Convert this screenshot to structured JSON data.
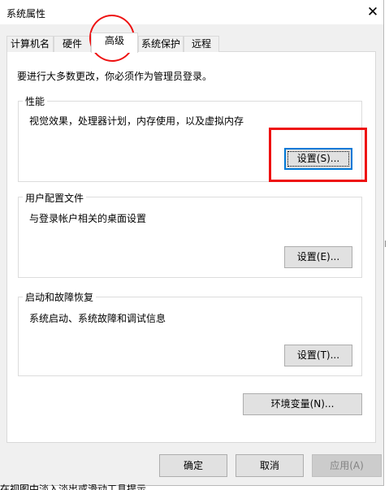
{
  "window": {
    "title": "系统属性",
    "close_symbol": "✕"
  },
  "tabs": [
    {
      "label": "计算机名"
    },
    {
      "label": "硬件"
    },
    {
      "label": "高级"
    },
    {
      "label": "系统保护"
    },
    {
      "label": "远程"
    }
  ],
  "intro": "要进行大多数更改，你必须作为管理员登录。",
  "performance": {
    "title": "性能",
    "desc": "视觉效果，处理器计划，内存使用，以及虚拟内存",
    "button": "设置(S)..."
  },
  "profiles": {
    "title": "用户配置文件",
    "desc": "与登录帐户相关的桌面设置",
    "button": "设置(E)..."
  },
  "startup": {
    "title": "启动和故障恢复",
    "desc": "系统启动、系统故障和调试信息",
    "button": "设置(T)..."
  },
  "env_button": "环境变量(N)...",
  "footer": {
    "ok": "确定",
    "cancel": "取消",
    "apply": "应用(A)"
  },
  "background_text": "在视图中淡入淡出或滑动工具提示",
  "colors": {
    "annotation": "#ee1111",
    "focus": "#0078d7"
  }
}
